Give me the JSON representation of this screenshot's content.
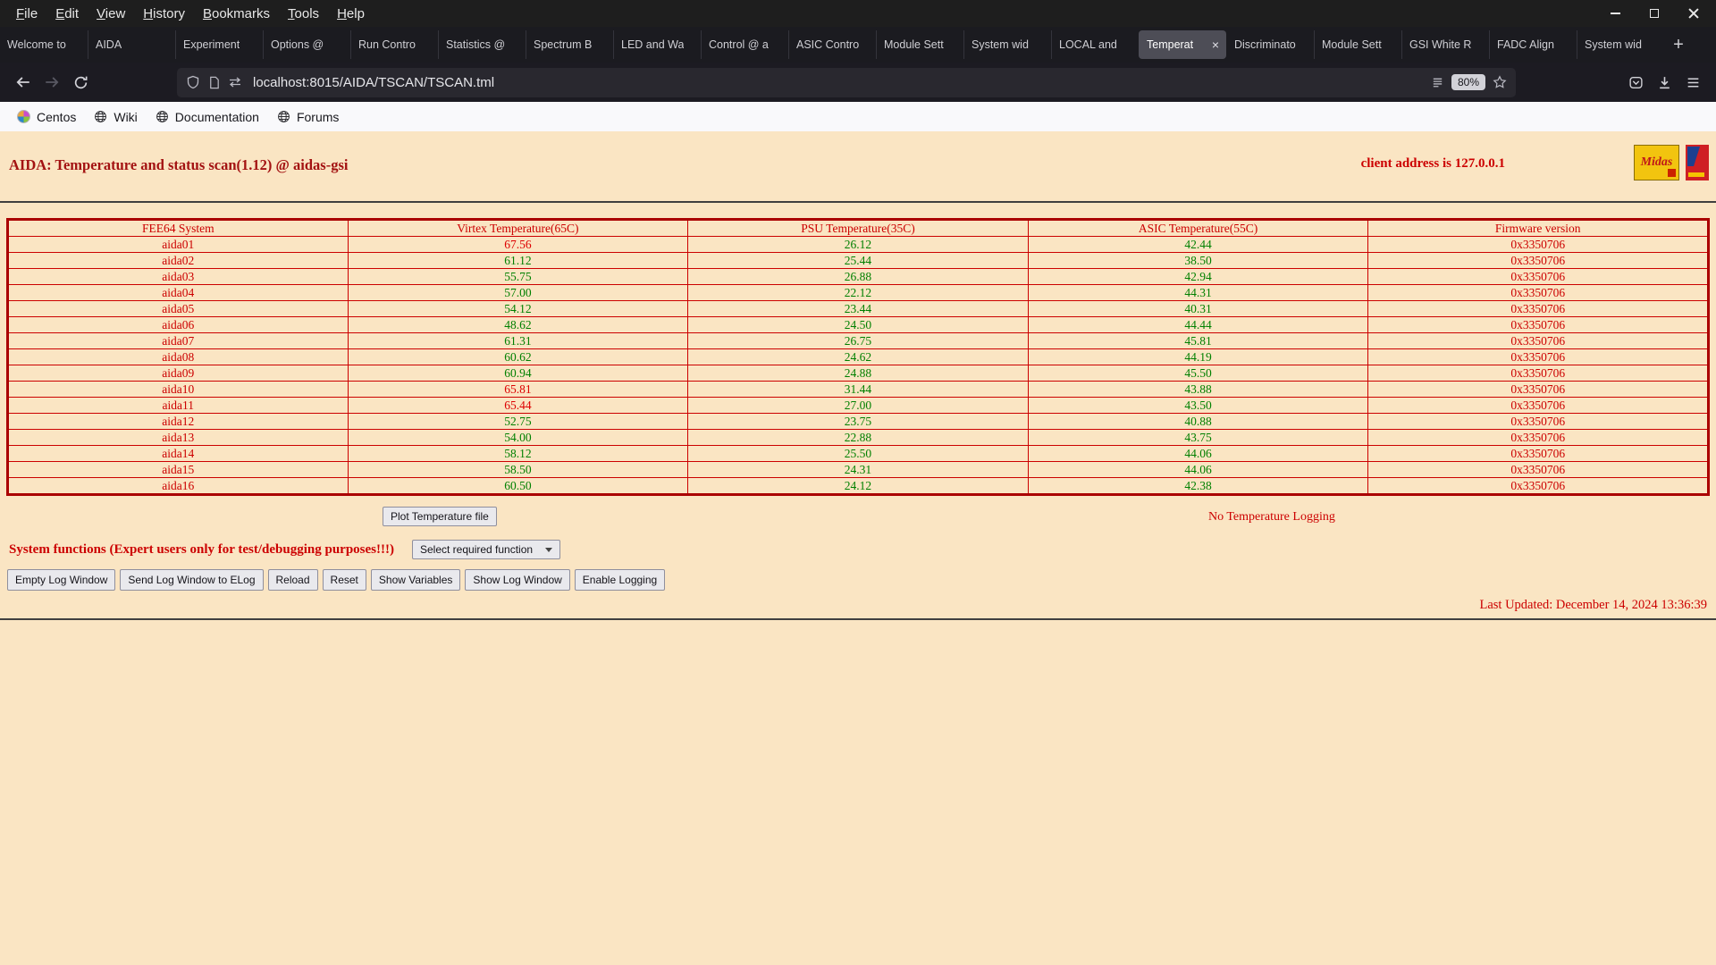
{
  "browser": {
    "menu": [
      "File",
      "Edit",
      "View",
      "History",
      "Bookmarks",
      "Tools",
      "Help"
    ],
    "window_controls": [
      "minimize",
      "maximize",
      "close"
    ],
    "tabs": [
      {
        "label": "Welcome to"
      },
      {
        "label": "AIDA"
      },
      {
        "label": "Experiment"
      },
      {
        "label": "Options @"
      },
      {
        "label": "Run Contro"
      },
      {
        "label": "Statistics @"
      },
      {
        "label": "Spectrum B"
      },
      {
        "label": "LED and Wa"
      },
      {
        "label": "Control @ a"
      },
      {
        "label": "ASIC Contro"
      },
      {
        "label": "Module Sett"
      },
      {
        "label": "System wid"
      },
      {
        "label": "LOCAL and"
      },
      {
        "label": "Temperat",
        "active": true
      },
      {
        "label": "Discriminato"
      },
      {
        "label": "Module Sett"
      },
      {
        "label": "GSI White R"
      },
      {
        "label": "FADC Align"
      },
      {
        "label": "System wid"
      }
    ],
    "icons": {
      "new_tab": "+",
      "tab_close": "×"
    },
    "url": "localhost:8015/AIDA/TSCAN/TSCAN.tml",
    "zoom": "80%",
    "bookmarks": [
      {
        "label": "Centos",
        "icon": "centos"
      },
      {
        "label": "Wiki",
        "icon": "globe"
      },
      {
        "label": "Documentation",
        "icon": "globe"
      },
      {
        "label": "Forums",
        "icon": "globe"
      }
    ]
  },
  "page": {
    "title": "AIDA: Temperature and status scan(1.12) @ aidas-gsi",
    "client_address": "client address is 127.0.0.1",
    "logos": {
      "midas": "Midas"
    },
    "table": {
      "headers": [
        "FEE64 System",
        "Virtex Temperature(65C)",
        "PSU Temperature(35C)",
        "ASIC Temperature(55C)",
        "Firmware version"
      ],
      "rows": [
        {
          "name": "aida01",
          "virtex": "67.56",
          "virtex_high": true,
          "psu": "26.12",
          "asic": "42.44",
          "firmware": "0x3350706"
        },
        {
          "name": "aida02",
          "virtex": "61.12",
          "virtex_high": false,
          "psu": "25.44",
          "asic": "38.50",
          "firmware": "0x3350706"
        },
        {
          "name": "aida03",
          "virtex": "55.75",
          "virtex_high": false,
          "psu": "26.88",
          "asic": "42.94",
          "firmware": "0x3350706"
        },
        {
          "name": "aida04",
          "virtex": "57.00",
          "virtex_high": false,
          "psu": "22.12",
          "asic": "44.31",
          "firmware": "0x3350706"
        },
        {
          "name": "aida05",
          "virtex": "54.12",
          "virtex_high": false,
          "psu": "23.44",
          "asic": "40.31",
          "firmware": "0x3350706"
        },
        {
          "name": "aida06",
          "virtex": "48.62",
          "virtex_high": false,
          "psu": "24.50",
          "asic": "44.44",
          "firmware": "0x3350706"
        },
        {
          "name": "aida07",
          "virtex": "61.31",
          "virtex_high": false,
          "psu": "26.75",
          "asic": "45.81",
          "firmware": "0x3350706"
        },
        {
          "name": "aida08",
          "virtex": "60.62",
          "virtex_high": false,
          "psu": "24.62",
          "asic": "44.19",
          "firmware": "0x3350706"
        },
        {
          "name": "aida09",
          "virtex": "60.94",
          "virtex_high": false,
          "psu": "24.88",
          "asic": "45.50",
          "firmware": "0x3350706"
        },
        {
          "name": "aida10",
          "virtex": "65.81",
          "virtex_high": true,
          "psu": "31.44",
          "asic": "43.88",
          "firmware": "0x3350706"
        },
        {
          "name": "aida11",
          "virtex": "65.44",
          "virtex_high": true,
          "psu": "27.00",
          "asic": "43.50",
          "firmware": "0x3350706"
        },
        {
          "name": "aida12",
          "virtex": "52.75",
          "virtex_high": false,
          "psu": "23.75",
          "asic": "40.88",
          "firmware": "0x3350706"
        },
        {
          "name": "aida13",
          "virtex": "54.00",
          "virtex_high": false,
          "psu": "22.88",
          "asic": "43.75",
          "firmware": "0x3350706"
        },
        {
          "name": "aida14",
          "virtex": "58.12",
          "virtex_high": false,
          "psu": "25.50",
          "asic": "44.06",
          "firmware": "0x3350706"
        },
        {
          "name": "aida15",
          "virtex": "58.50",
          "virtex_high": false,
          "psu": "24.31",
          "asic": "44.06",
          "firmware": "0x3350706"
        },
        {
          "name": "aida16",
          "virtex": "60.50",
          "virtex_high": false,
          "psu": "24.12",
          "asic": "42.38",
          "firmware": "0x3350706"
        }
      ]
    },
    "plot_button": "Plot Temperature file",
    "no_logging": "No Temperature Logging",
    "system_functions_label": "System functions (Expert users only for test/debugging purposes!!!)",
    "select_value": "Select required function",
    "buttons": [
      "Empty Log Window",
      "Send Log Window to ELog",
      "Reload",
      "Reset",
      "Show Variables",
      "Show Log Window",
      "Enable Logging"
    ],
    "last_updated": "Last Updated: December 14, 2024 13:36:39",
    "colors": {
      "accent_red": "#cc0000",
      "title_red": "#a31212",
      "ok_green": "#008000",
      "alarm_red": "#dd0000",
      "page_bg": "#fae5c3"
    }
  }
}
